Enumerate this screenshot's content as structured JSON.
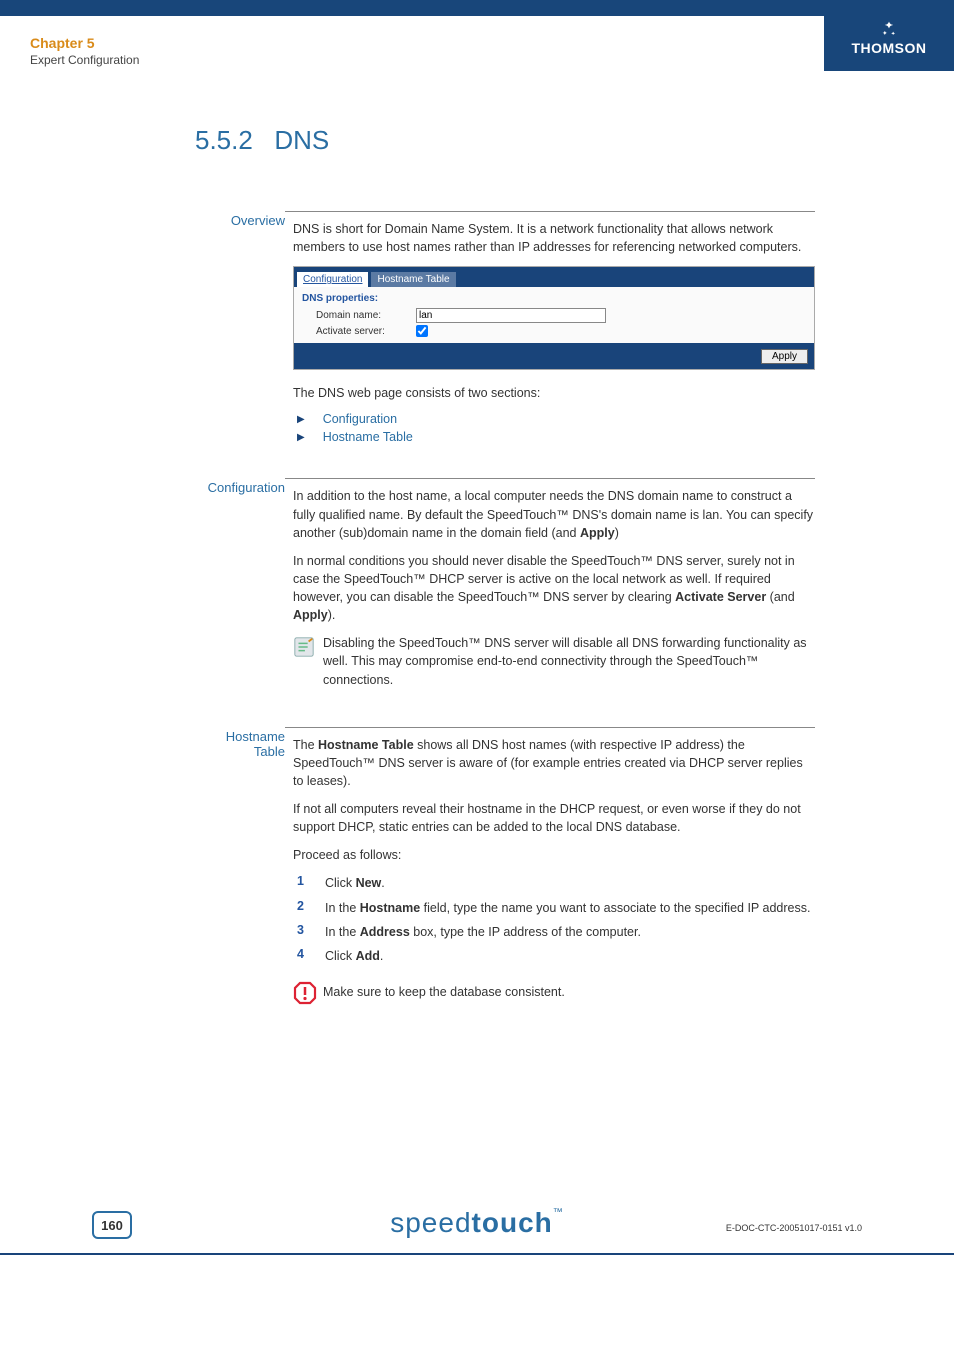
{
  "chapter": {
    "title": "Chapter 5",
    "subtitle": "Expert Configuration"
  },
  "brand": "THOMSON",
  "section": {
    "number": "5.5.2",
    "title": "DNS"
  },
  "overview": {
    "label": "Overview",
    "intro": "DNS is short for Domain Name System. It is a network functionality that allows network members to use host names rather than IP addresses for referencing networked computers.",
    "twosections": "The DNS web page consists of two sections:",
    "bullets": [
      "Configuration",
      "Hostname Table"
    ]
  },
  "uicapture": {
    "tab_active": "Configuration",
    "tab_inactive": "Hostname Table",
    "heading": "DNS properties:",
    "domain_label": "Domain name:",
    "domain_value": "lan",
    "activate_label": "Activate server:",
    "apply": "Apply"
  },
  "configuration": {
    "label": "Configuration",
    "p1_a": "In addition to the host name, a local computer needs the DNS domain name to construct a fully qualified name. By default the SpeedTouch™ DNS's domain name is lan. You can specify another (sub)domain name in the domain field (and ",
    "p1_b": "Apply",
    "p1_c": ")",
    "p2_a": "In normal conditions you should never disable the SpeedTouch™ DNS server, surely not in case the SpeedTouch™ DHCP server is active on the local network as well. If required however, you can disable the SpeedTouch™ DNS server by clearing ",
    "p2_b": "Activate Server",
    "p2_c": " (and ",
    "p2_d": "Apply",
    "p2_e": ").",
    "note": "Disabling the SpeedTouch™ DNS server will disable all DNS forwarding functionality as well. This may compromise end-to-end connectivity through the SpeedTouch™ connections."
  },
  "hostname": {
    "label": "Hostname Table",
    "p1_a": "The ",
    "p1_b": "Hostname Table",
    "p1_c": " shows all DNS host names (with respective IP address) the SpeedTouch™ DNS server is aware of (for example entries created via DHCP server replies to leases).",
    "p2": "If not all computers reveal their hostname in the DHCP request, or even worse if they do not support DHCP, static entries can be added to the local DNS database.",
    "proceed": "Proceed as follows:",
    "steps": {
      "s1_a": "Click ",
      "s1_b": "New",
      "s1_c": ".",
      "s2_a": "In the ",
      "s2_b": "Hostname",
      "s2_c": " field, type the name you want to associate to the specified IP address.",
      "s3_a": "In the ",
      "s3_b": "Address",
      "s3_c": " box, type the IP address of the computer.",
      "s4_a": "Click ",
      "s4_b": "Add",
      "s4_c": "."
    },
    "warn": "Make sure to keep the database consistent."
  },
  "footer": {
    "logo_thin": "speed",
    "logo_bold": "touch",
    "page": "160",
    "docid": "E-DOC-CTC-20051017-0151 v1.0"
  }
}
